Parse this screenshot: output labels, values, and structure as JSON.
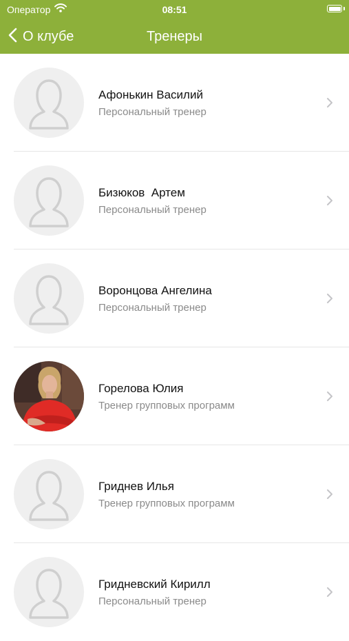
{
  "status_bar": {
    "carrier": "Оператор",
    "time": "08:51",
    "icons": [
      "wifi-icon",
      "battery-icon"
    ]
  },
  "nav": {
    "back_label": "О клубе",
    "title": "Тренеры",
    "back_icon": "chevron-left-icon"
  },
  "colors": {
    "accent": "#8db03a",
    "avatar_bg": "#efefef",
    "avatar_outline": "#cfcfcf",
    "separator": "#e6e6e6",
    "subtitle": "#8a8a8a",
    "chevron": "#c4c4c7"
  },
  "trainers": [
    {
      "name": "Афонькин Василий",
      "role": "Персональный тренер",
      "avatar": "placeholder-user-icon"
    },
    {
      "name": "Бизюков  Артем",
      "role": "Персональный тренер",
      "avatar": "placeholder-user-icon"
    },
    {
      "name": "Воронцова Ангелина",
      "role": "Персональный тренер",
      "avatar": "placeholder-user-icon"
    },
    {
      "name": "Горелова Юлия",
      "role": "Тренер групповых программ",
      "avatar": "photo"
    },
    {
      "name": "Гриднев Илья",
      "role": "Тренер групповых программ",
      "avatar": "placeholder-user-icon"
    },
    {
      "name": "Гридневский Кирилл",
      "role": "Персональный тренер",
      "avatar": "placeholder-user-icon"
    }
  ]
}
